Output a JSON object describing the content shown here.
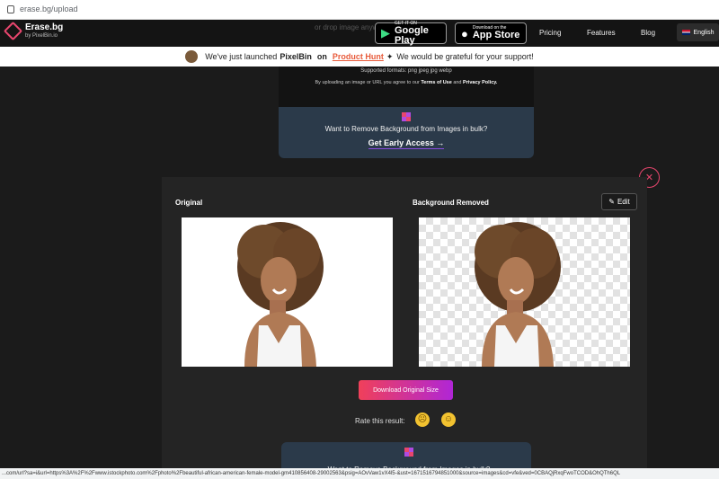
{
  "browser": {
    "url": "erase.bg/upload"
  },
  "nav": {
    "brand": "Erase.bg",
    "brand_sub": "by PixelBin.io",
    "faded_text": "or drop image anywhere",
    "google_play": {
      "small": "GET IT ON",
      "big": "Google Play"
    },
    "app_store": {
      "small": "Download on the",
      "big": "App Store"
    },
    "links": [
      "Pricing",
      "Features",
      "Blog"
    ],
    "language": "English"
  },
  "banner": {
    "pre": "We've just launched",
    "brand": "PixelBin",
    "on": "on",
    "product_hunt": "Product Hunt",
    "post": "We would be grateful for your support!"
  },
  "upload_card": {
    "formats": "Supported formats: png jpeg jpg webp",
    "terms_pre": "By uploading an image or URL you agree to our",
    "terms_link": "Terms of Use",
    "and": "and",
    "privacy_link": "Privacy Policy."
  },
  "bulk": {
    "question": "Want to Remove Background from Images in bulk?",
    "cta": "Get Early Access →"
  },
  "result": {
    "original_label": "Original",
    "removed_label": "Background Removed",
    "edit_label": "Edit",
    "download_label": "Download Original Size",
    "rate_label": "Rate this result:"
  },
  "status_url": "...com/url?sa=i&url=https%3A%2F%2Fwww.istockphoto.com%2Fphoto%2Fbeautiful-african-american-female-model-gm410856408-29002563&psig=AOvVaw1vX4l5-&ust=1671516794851000&source=images&cd=vfe&ved=0CBAQjRxqFwoTCOD&OhQTh6QL"
}
